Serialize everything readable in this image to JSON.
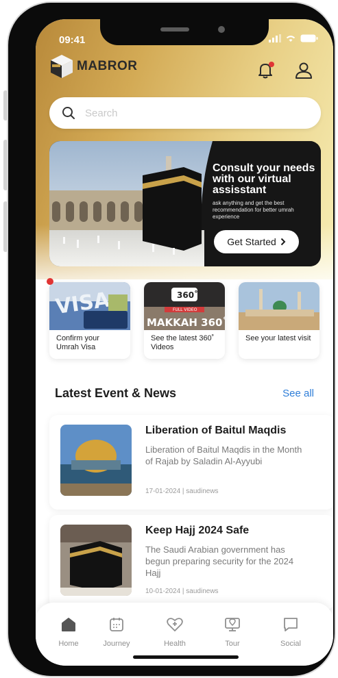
{
  "status": {
    "time": "09:41"
  },
  "brand": {
    "name": "MABROR"
  },
  "search": {
    "placeholder": "Search"
  },
  "hero": {
    "title": "Consult your needs with our virtual assisstant",
    "subtitle": "ask anything and get the best recommendation for better umrah experience",
    "button_label": "Get Started"
  },
  "quick_cards": [
    {
      "label": "Confirm your Umrah Visa",
      "image_text": "VISA"
    },
    {
      "label": "See the latest 360˚ Videos",
      "image_text": "MAKKAH 360˚",
      "badge_text": "360˚",
      "ribbon_text": "FULL VIDEO"
    },
    {
      "label": "See your latest visit"
    }
  ],
  "news_section": {
    "title": "Latest Event & News",
    "see_all": "See all"
  },
  "news": [
    {
      "title": "Liberation of Baitul Maqdis",
      "description": "Liberation of Baitul Maqdis in the Month of Rajab by Saladin Al-Ayyubi",
      "meta": "17-01-2024 | saudinews"
    },
    {
      "title": "Keep Hajj 2024 Safe",
      "description": "The Saudi Arabian government has begun preparing security for the 2024 Hajj",
      "meta": "10-01-2024 | saudinews"
    }
  ],
  "nav": [
    {
      "label": "Home",
      "icon": "home-icon",
      "active": true
    },
    {
      "label": "Journey",
      "icon": "calendar-icon"
    },
    {
      "label": "Health",
      "icon": "heart-plus-icon"
    },
    {
      "label": "Tour",
      "icon": "monitor-location-icon"
    },
    {
      "label": "Social",
      "icon": "chat-icon"
    }
  ],
  "colors": {
    "gold_dark": "#b8893a",
    "gold_light": "#f7eeb6",
    "link_blue": "#2f7ed8",
    "notification_red": "#e03434"
  }
}
